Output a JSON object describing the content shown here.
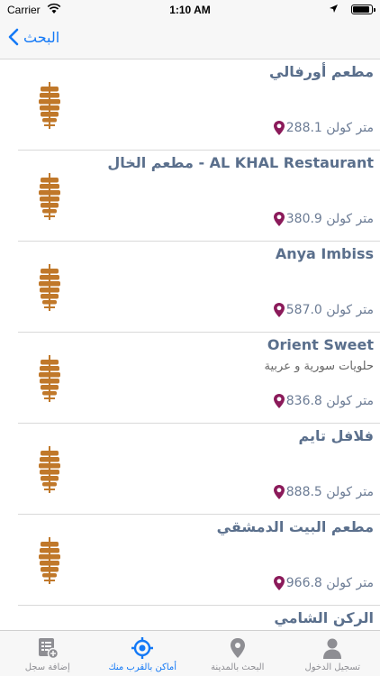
{
  "status_bar": {
    "carrier": "Carrier",
    "time": "1:10 AM"
  },
  "navbar": {
    "back_label": "البحث"
  },
  "places": [
    {
      "name": "مطعم أورفالي",
      "subtitle": "",
      "distance": "288.1 متر كولن"
    },
    {
      "name": "AL KHAL Restaurant - مطعم الخال",
      "subtitle": "",
      "distance": "380.9 متر كولن"
    },
    {
      "name": "Anya Imbiss",
      "subtitle": "",
      "distance": "587.0 متر كولن"
    },
    {
      "name": "Orient Sweet",
      "subtitle": "حلويات سورية و عربية",
      "distance": "836.8 متر كولن"
    },
    {
      "name": "فلافل تايم",
      "subtitle": "",
      "distance": "888.5 متر كولن"
    },
    {
      "name": "مطعم البيت الدمشقي",
      "subtitle": "",
      "distance": "966.8 متر كولن"
    },
    {
      "name": "الركن الشامي"
    }
  ],
  "tabs": [
    {
      "label": "إضافة سجل",
      "icon": "add-record-icon"
    },
    {
      "label": "أماكن بالقرب منك",
      "icon": "nearby-target-icon"
    },
    {
      "label": "البحث بالمدينة",
      "icon": "city-pin-icon"
    },
    {
      "label": "تسجيل الدخول",
      "icon": "user-icon"
    }
  ],
  "colors": {
    "accent": "#1479f6",
    "title": "#5a6f8c",
    "distance": "#6c7c95",
    "pin": "#8b1a5a",
    "kebab": "#c0782a"
  }
}
